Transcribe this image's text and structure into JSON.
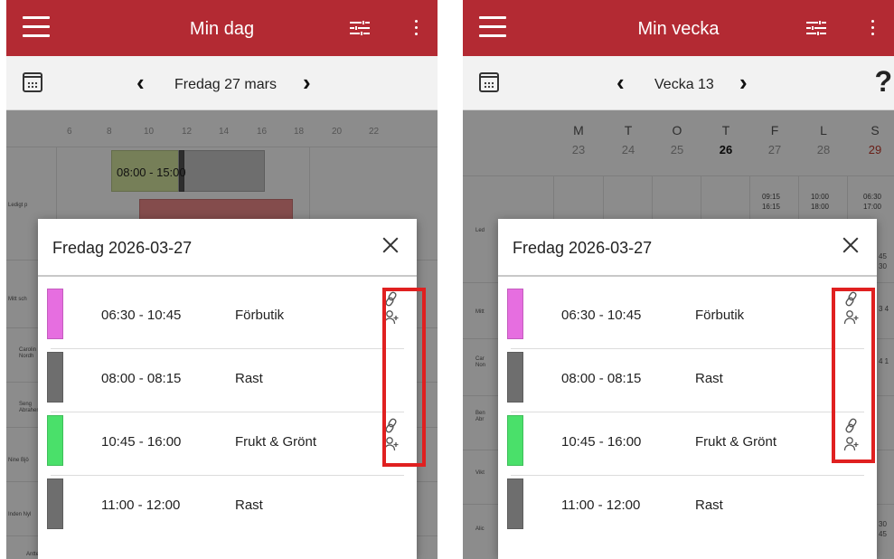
{
  "left": {
    "appbar": {
      "title": "Min dag"
    },
    "nav": {
      "label": "Fredag 27 mars"
    },
    "timeline": {
      "hours": [
        "6",
        "8",
        "10",
        "12",
        "14",
        "16",
        "18",
        "20",
        "22"
      ],
      "persons": [
        "Ledigt p",
        "Mitt sch",
        "Carolin Nordh",
        "Seng Abrahen",
        "Nine Bjö",
        "Inden Nyl",
        "Antte"
      ],
      "bg_shift": "08:00 - 15:00"
    },
    "modal": {
      "title": "Fredag 2026-03-27",
      "entries": [
        {
          "time": "06:30 - 10:45",
          "name": "Förbutik",
          "color": "#e66ee0",
          "icons": true
        },
        {
          "time": "08:00 - 08:15",
          "name": "Rast",
          "color": "#6e6e6e",
          "icons": false
        },
        {
          "time": "10:45 - 16:00",
          "name": "Frukt & Grönt",
          "color": "#4ae06a",
          "icons": true
        },
        {
          "time": "11:00 - 12:00",
          "name": "Rast",
          "color": "#6e6e6e",
          "icons": false
        }
      ]
    }
  },
  "right": {
    "appbar": {
      "title": "Min vecka"
    },
    "nav": {
      "label": "Vecka 13",
      "help": "?"
    },
    "week": {
      "days": [
        {
          "letter": "M",
          "num": "23"
        },
        {
          "letter": "T",
          "num": "24"
        },
        {
          "letter": "O",
          "num": "25"
        },
        {
          "letter": "T",
          "num": "26"
        },
        {
          "letter": "F",
          "num": "27"
        },
        {
          "letter": "L",
          "num": "28"
        },
        {
          "letter": "S",
          "num": "29"
        }
      ],
      "mini_times": [
        "09:15 16:15",
        "10:00 18:00",
        "06:30 17:00"
      ],
      "persons": [
        "Led",
        "Mitt",
        "Car Non",
        "Ben Abr",
        "Vikt",
        "Alic"
      ],
      "edge_values": [
        "45 30",
        "3 4",
        "4 1",
        "30 45"
      ]
    },
    "modal": {
      "title": "Fredag 2026-03-27",
      "entries": [
        {
          "time": "06:30 - 10:45",
          "name": "Förbutik",
          "color": "#e66ee0",
          "icons": true
        },
        {
          "time": "08:00 - 08:15",
          "name": "Rast",
          "color": "#6e6e6e",
          "icons": false
        },
        {
          "time": "10:45 - 16:00",
          "name": "Frukt & Grönt",
          "color": "#4ae06a",
          "icons": true
        },
        {
          "time": "11:00 - 12:00",
          "name": "Rast",
          "color": "#6e6e6e",
          "icons": false
        }
      ]
    }
  },
  "theme": {
    "brand": "#b32a33",
    "highlight": "#e02020"
  }
}
